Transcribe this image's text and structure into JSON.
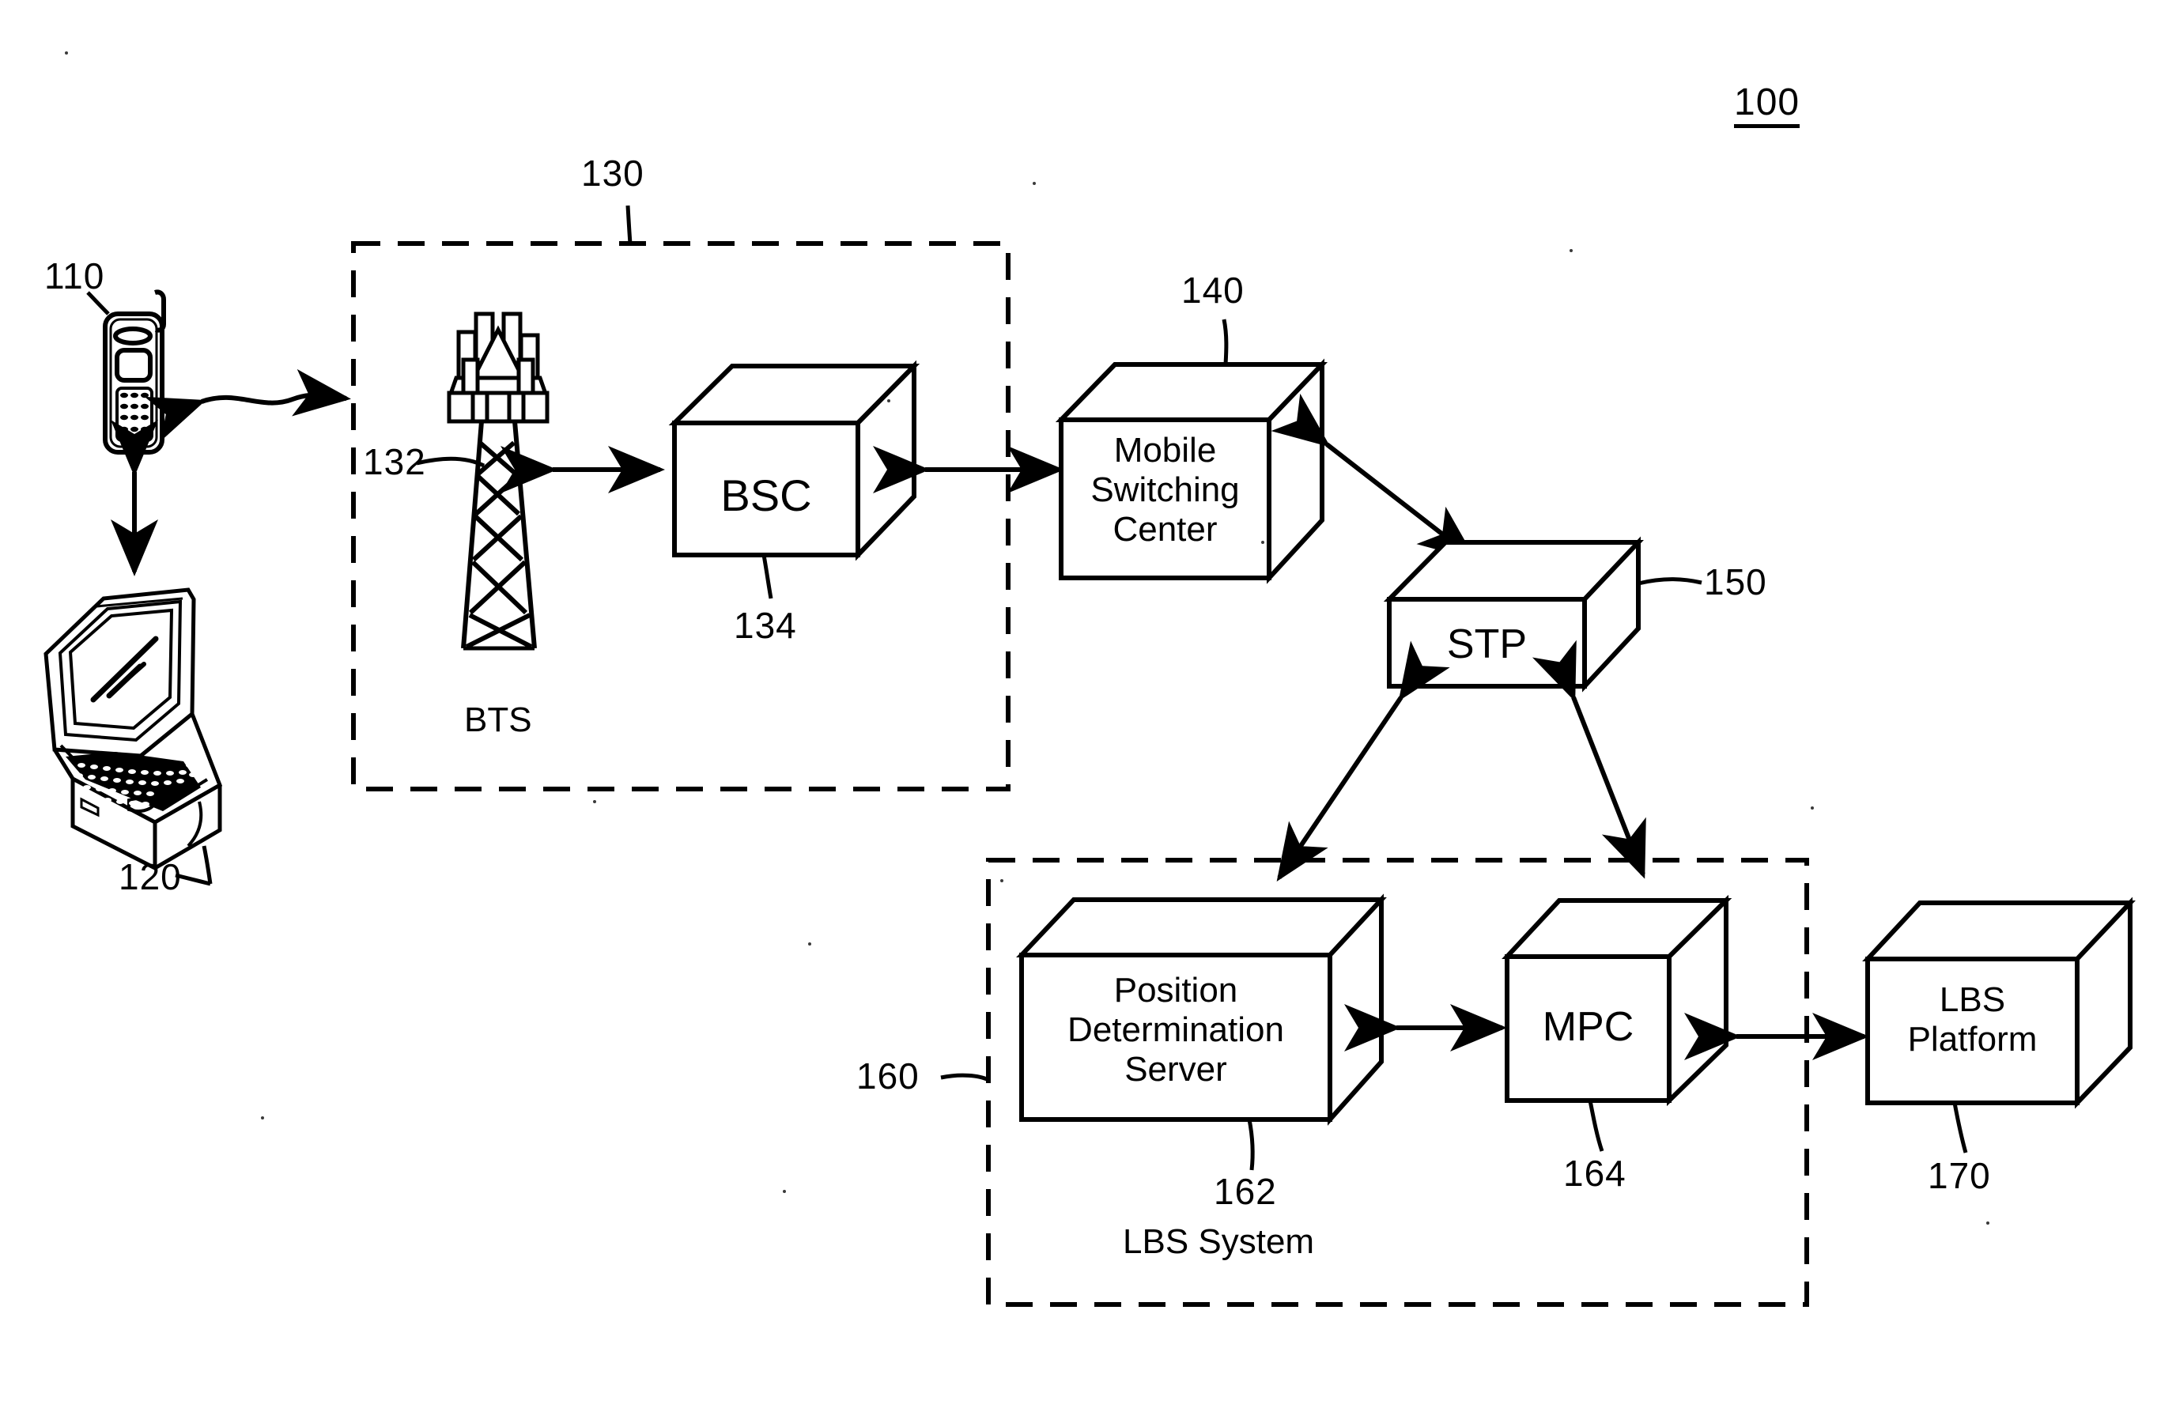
{
  "figure": {
    "number": "100",
    "type": "patent-block-diagram",
    "title_text": "100"
  },
  "reference_numerals": {
    "system": "100",
    "mobile_phone": "110",
    "laptop": "120",
    "bts_group": "130",
    "antenna_tower": "132",
    "bsc": "134",
    "msc": "140",
    "stp": "150",
    "lbs_system": "160",
    "position_determination_server": "162",
    "mpc": "164",
    "lbs_platform": "170"
  },
  "nodes": {
    "mobile_phone": {
      "label": "",
      "ref": "110",
      "kind": "device-icon"
    },
    "laptop": {
      "label": "",
      "ref": "120",
      "kind": "device-icon"
    },
    "antenna_tower": {
      "label": "",
      "ref": "132",
      "kind": "tower-icon"
    },
    "bsc": {
      "label": "BSC",
      "ref": "134",
      "kind": "cube"
    },
    "msc": {
      "label": "Mobile\nSwitching\nCenter",
      "line1": "Mobile",
      "line2": "Switching",
      "line3": "Center",
      "ref": "140",
      "kind": "cube"
    },
    "stp": {
      "label": "STP",
      "ref": "150",
      "kind": "flat-cube"
    },
    "pds": {
      "label": "Position\nDetermination\nServer",
      "line1": "Position",
      "line2": "Determination",
      "line3": "Server",
      "ref": "162",
      "kind": "cube"
    },
    "mpc": {
      "label": "MPC",
      "ref": "164",
      "kind": "cube"
    },
    "lbs_platform": {
      "label": "LBS\nPlatform",
      "line1": "LBS",
      "line2": "Platform",
      "ref": "170",
      "kind": "cube"
    }
  },
  "group_labels": {
    "bts": "BTS",
    "lbs_system": "LBS System"
  },
  "connections": [
    {
      "from": "mobile_phone",
      "to": "bts_group",
      "style": "double-arrow-wavy"
    },
    {
      "from": "mobile_phone",
      "to": "laptop",
      "style": "double-arrow-vertical"
    },
    {
      "from": "antenna_tower",
      "to": "bsc",
      "style": "double-arrow"
    },
    {
      "from": "bsc",
      "to": "msc",
      "style": "double-arrow"
    },
    {
      "from": "msc",
      "to": "stp",
      "style": "double-arrow-diagonal"
    },
    {
      "from": "pds",
      "to": "stp",
      "style": "double-arrow-diagonal"
    },
    {
      "from": "mpc",
      "to": "stp",
      "style": "double-arrow-diagonal"
    },
    {
      "from": "pds",
      "to": "mpc",
      "style": "double-arrow"
    },
    {
      "from": "mpc",
      "to": "lbs_platform",
      "style": "double-arrow"
    }
  ],
  "colors": {
    "stroke": "#000000",
    "background": "#ffffff"
  }
}
